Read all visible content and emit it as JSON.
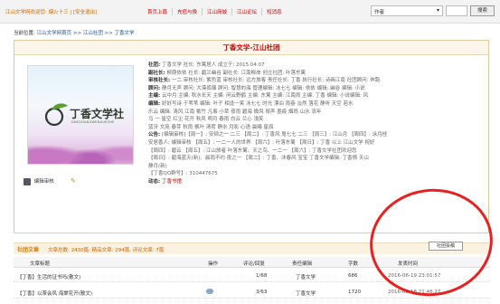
{
  "topbar": {
    "welcome": "江山文学网欢迎您: 烟火十三 | [安全退出]",
    "nav": [
      "首页上篇",
      "充值与换",
      "江山商城",
      "江山论坛",
      "短消息"
    ],
    "search_select": "作者",
    "search_button": "搜索"
  },
  "breadcrumb": {
    "prefix": "当前位置:",
    "path": "江山文学网首页 >> 江山社团 >> 丁香文学"
  },
  "club": {
    "title": "丁香文学-江山社团",
    "logo_name": "丁香文学社",
    "logo_pinyin": "DINGXIANGWENXUESHE",
    "manager_label": "编辑审核",
    "info_lines": [
      {
        "k": "社团:",
        "v": "丁香文学   社长: 东篱居人   成立于: 2015.04.07"
      },
      {
        "k": "副社长:",
        "v": "柳荫依依  社长: 碧兰幽谷  副社长: 江南柳岸  创立社团: 叶落东篱"
      },
      {
        "k": "审核社长:",
        "v": "一二  审核社长: 紫色蓝  审核社长: 远方旅客  责任社长: 丁香  执行社长: 诗画江南  社团顾问: 奔跑"
      },
      {
        "k": "顾问:",
        "v": "静月无声  顾问: 大漠孤烟  顾问: 智慧的海  管理编辑: 冰七七  编辑: 依依  编辑: 幽谷  编辑: 小说"
      },
      {
        "k": "主编:",
        "v": "云中月  主编: 秋水长天  主编: 闲云野鹤  主编: 东篱  主编: 江南雨  主编: 丁香  编辑: 小说编辑: 风"
      },
      {
        "k": "编辑:",
        "v": "好好写诗  于苇苇  编辑: 叶子  相逢一笑  冰七七  时光  漂泊  雨巷  淡然  落花  静听  天空  若水"
      },
      {
        "k": "",
        "v": "乐云  编辑: 清风  江南  紫竹  凡事  小草  夜雨  碧海  微风  琴声  墨痕  烟雨  山水  流年"
      },
      {
        "k": "",
        "v": "马  一  星空  红尘  花开  秋风  明月  春雨  白云  兰心  浅笑"
      },
      {
        "k": "",
        "v": "蓝牙  文苑  春芽  秋雨  枫叶  清荷  静水  月影  心语  晨曦  星辰"
      },
      {
        "k": "公告:",
        "v": "[编辑审核]【周一】: 安顿之一 二三 【周二】: 丁香风 鬼七七 二三 【周三】: 江山月 【周四】: 泳月桂"
      },
      {
        "k": "",
        "v": "安居香人; 编辑审核 【周五】: 一二一人的世界 【周六】: 叶落东篱 【周日】: 丁香 以上 江山文学 祝好"
      },
      {
        "k": "",
        "v": "【周四】: 碧云 【周五】: 江山旅者 叶落东篱、天之鸟、一二一 【周六】: 丁香文学社团欢迎您"
      },
      {
        "k": "",
        "v": "【周日】: 碧海蓝天(新)、晨雨不约 夜之一 【周二】: 丁香、沐春风 宝宝  丁香文学编辑: 丁香情  天山"
      },
      {
        "k": "",
        "v": "静月(新)"
      },
      {
        "k": "",
        "v": "【丁香QQ群号】: 310447675"
      },
      {
        "k": "动态:",
        "v": "丁香书馆",
        "hl": true
      }
    ]
  },
  "stats": {
    "label": "社团文章",
    "numbers": "文章总数: 2430篇, 精品文章: 294篇, 评论文章: 7篇",
    "rss_button": "社团投稿"
  },
  "table": {
    "headers": [
      "文章标题",
      "操作",
      "评论/回复",
      "责任编辑",
      "字数",
      "发表时间"
    ],
    "rows": [
      {
        "title": "【丁香】生活的证书吗(散文)",
        "op": "",
        "comments": "1/68",
        "editor": "丁香文学",
        "words": "686",
        "time": "2016-06-19 23:01:57"
      },
      {
        "title": "【丁香】以茶会风 海棠花开(散文)",
        "op": "cloud",
        "comments": "3/63",
        "editor": "丁香文学",
        "words": "1720",
        "time": "2016-06-18 21:46:27"
      }
    ]
  },
  "colors": {
    "accent": "#c00000",
    "orange": "#e07b00",
    "annotation": "#e8201f"
  }
}
